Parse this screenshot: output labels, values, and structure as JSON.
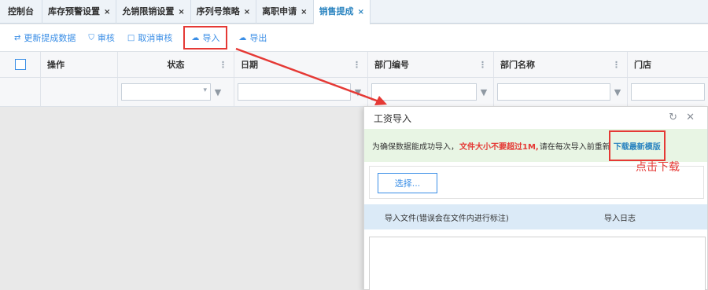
{
  "tabs": [
    {
      "label": "控制台",
      "closable": false
    },
    {
      "label": "库存预警设置",
      "closable": true
    },
    {
      "label": "允销限销设置",
      "closable": true
    },
    {
      "label": "序列号策略",
      "closable": true
    },
    {
      "label": "离职申请",
      "closable": true
    },
    {
      "label": "销售提成",
      "closable": true,
      "active": true
    }
  ],
  "tab_close_glyph": "×",
  "toolbar": {
    "refresh": {
      "label": "更新提成数据",
      "icon": "swap-icon"
    },
    "audit": {
      "label": "审核",
      "icon": "shield-icon"
    },
    "unaudit": {
      "label": "取消审核",
      "icon": "square-icon"
    },
    "import": {
      "label": "导入",
      "icon": "cloud-upload-icon"
    },
    "export": {
      "label": "导出",
      "icon": "cloud-download-icon"
    }
  },
  "grid": {
    "columns": [
      "操作",
      "状态",
      "日期",
      "部门编号",
      "部门名称",
      "门店"
    ]
  },
  "modal": {
    "title": "工资导入",
    "notice_prefix": "为确保数据能成功导入，",
    "notice_warning": "文件大小不要超过1M,",
    "notice_suffix": "请在每次导入前重新",
    "download_link": "下载最新模版",
    "select_button": "选择...",
    "col_file": "导入文件(错误会在文件内进行标注)",
    "col_log": "导入日志"
  },
  "annotation": "点击下载",
  "colors": {
    "accent": "#3a8ee6",
    "highlight": "#e53935",
    "notice_bg": "#e8f5e4"
  }
}
